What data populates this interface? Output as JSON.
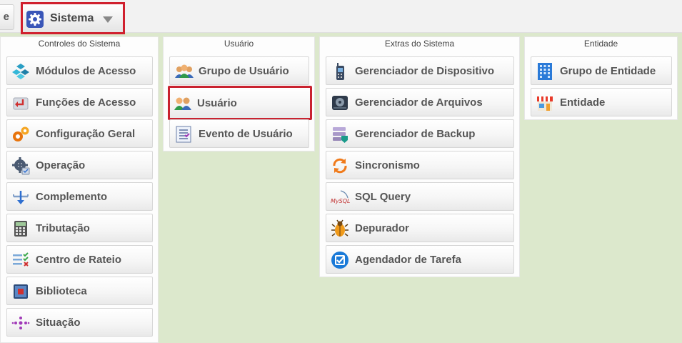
{
  "topbar": {
    "prev_tab_label": "e",
    "sistema_label": "Sistema"
  },
  "panels": [
    {
      "title": "Controles do Sistema",
      "items": [
        {
          "label": "Módulos de Acesso",
          "icon": "modules-icon"
        },
        {
          "label": "Funções de Acesso",
          "icon": "access-functions-icon"
        },
        {
          "label": "Configuração Geral",
          "icon": "gears-icon"
        },
        {
          "label": "Operação",
          "icon": "operation-gear-icon"
        },
        {
          "label": "Complemento",
          "icon": "complement-icon"
        },
        {
          "label": "Tributação",
          "icon": "calculator-icon"
        },
        {
          "label": "Centro de Rateio",
          "icon": "checklist-icon"
        },
        {
          "label": "Biblioteca",
          "icon": "library-icon"
        },
        {
          "label": "Situação",
          "icon": "situation-icon"
        }
      ]
    },
    {
      "title": "Usuário",
      "items": [
        {
          "label": "Grupo de Usuário",
          "icon": "user-group-icon"
        },
        {
          "label": "Usuário",
          "icon": "users-icon",
          "selected": true
        },
        {
          "label": "Evento de Usuário",
          "icon": "event-list-icon"
        }
      ]
    },
    {
      "title": "Extras do Sistema",
      "items": [
        {
          "label": "Gerenciador de Dispositivo",
          "icon": "device-icon"
        },
        {
          "label": "Gerenciador de Arquivos",
          "icon": "disk-icon"
        },
        {
          "label": "Gerenciador de Backup",
          "icon": "backup-icon"
        },
        {
          "label": "Sincronismo",
          "icon": "sync-icon"
        },
        {
          "label": "SQL Query",
          "icon": "mysql-icon"
        },
        {
          "label": "Depurador",
          "icon": "bug-icon"
        },
        {
          "label": "Agendador de Tarefa",
          "icon": "scheduler-check-icon"
        }
      ]
    },
    {
      "title": "Entidade",
      "items": [
        {
          "label": "Grupo de Entidade",
          "icon": "building-icon"
        },
        {
          "label": "Entidade",
          "icon": "store-icon"
        }
      ]
    }
  ],
  "colors": {
    "background": "#dce8cc",
    "highlight": "#c9222f",
    "text": "#555555"
  }
}
